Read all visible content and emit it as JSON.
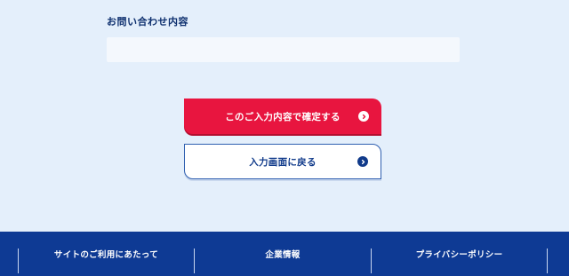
{
  "form": {
    "inquiry_label": "お問い合わせ内容",
    "inquiry_value": ""
  },
  "actions": {
    "confirm_label": "このご入力内容で確定する",
    "back_label": "入力画面に戻る"
  },
  "footer": {
    "links": [
      "サイトのご利用にあたって",
      "企業情報",
      "プライバシーポリシー"
    ]
  },
  "colors": {
    "background": "#e4effb",
    "primary_red": "#e8153f",
    "navy": "#0e3a94"
  },
  "icons": {
    "button_arrow": "chevron-right-circle-icon"
  }
}
